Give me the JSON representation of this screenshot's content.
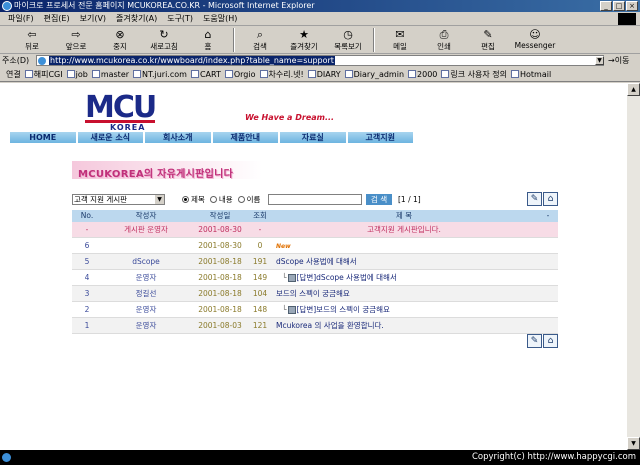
{
  "window": {
    "title": "마이크로 프로세서 전문 홈페이지 MCUKOREA.CO.KR - Microsoft Internet Explorer"
  },
  "menu": [
    "파일(F)",
    "편집(E)",
    "보기(V)",
    "즐겨찾기(A)",
    "도구(T)",
    "도움말(H)"
  ],
  "toolbar": [
    {
      "label": "뒤로",
      "icon": "back-arrow-icon"
    },
    {
      "label": "앞으로",
      "icon": "forward-arrow-icon"
    },
    {
      "label": "중지",
      "icon": "stop-icon"
    },
    {
      "label": "새로고침",
      "icon": "refresh-icon"
    },
    {
      "label": "홈",
      "icon": "home-icon"
    },
    {
      "label": "검색",
      "icon": "search-icon"
    },
    {
      "label": "즐겨찾기",
      "icon": "favorites-icon"
    },
    {
      "label": "목록보기",
      "icon": "history-icon"
    },
    {
      "label": "메일",
      "icon": "mail-icon"
    },
    {
      "label": "인쇄",
      "icon": "print-icon"
    },
    {
      "label": "편집",
      "icon": "edit-icon"
    },
    {
      "label": "Messenger",
      "icon": "messenger-icon"
    }
  ],
  "address": {
    "label": "주소(D)",
    "url": "http://www.mcukorea.co.kr/wwwboard/index.php?table_name=support",
    "go": "이동"
  },
  "links": {
    "label": "연결",
    "items": [
      "해피CGI",
      "job",
      "master",
      "NT.juri.com",
      "CART",
      "Orgio",
      "차수리.넷!",
      "DIARY",
      "Diary_admin",
      "2000",
      "링크 사용자 정의",
      "Hotmail"
    ]
  },
  "site": {
    "logo": "MCU",
    "logo_sub": "KOREA",
    "slogan": "We Have a Dream...",
    "nav": [
      "HOME",
      "새로운 소식",
      "회사소개",
      "제품안내",
      "자료실",
      "고객지원"
    ],
    "board_title": "MCUKOREA의 자유게시판입니다"
  },
  "board": {
    "select_value": "고객 지원 게시판",
    "radios": [
      {
        "label": "제목",
        "checked": true
      },
      {
        "label": "내용",
        "checked": false
      },
      {
        "label": "이름",
        "checked": false
      }
    ],
    "search_button": "검 색",
    "pager": "[1 / 1]",
    "headers": [
      "No.",
      "작성자",
      "작성일",
      "조회",
      "제 목",
      "-"
    ],
    "rows": [
      {
        "no": "-",
        "writer": "게시판 운영자",
        "date": "2001-08-30",
        "hits": "-",
        "subject": "고객지원 게시판입니다.",
        "type": "notice"
      },
      {
        "no": "6",
        "writer": "",
        "date": "2001-08-30",
        "hits": "0",
        "subject": "",
        "new": "New",
        "type": "normal"
      },
      {
        "no": "5",
        "writer": "dScope",
        "date": "2001-08-18",
        "hits": "191",
        "subject": "dScope 사용법에 대해서",
        "type": "normal"
      },
      {
        "no": "4",
        "writer": "운영자",
        "date": "2001-08-18",
        "hits": "149",
        "subject": "[답변]dScope 사용법에 대해서",
        "type": "reply"
      },
      {
        "no": "3",
        "writer": "정길선",
        "date": "2001-08-18",
        "hits": "104",
        "subject": "보드의 스펙이 궁금해요",
        "type": "normal"
      },
      {
        "no": "2",
        "writer": "운영자",
        "date": "2001-08-18",
        "hits": "148",
        "subject": "[답변]보드의 스펙이 궁금해요",
        "type": "reply"
      },
      {
        "no": "1",
        "writer": "운영자",
        "date": "2001-08-03",
        "hits": "121",
        "subject": "Mcukorea 의 사업을 환영합니다.",
        "type": "normal"
      }
    ]
  },
  "status": {
    "text": "Copyright(c) http://www.happycgi.com"
  }
}
